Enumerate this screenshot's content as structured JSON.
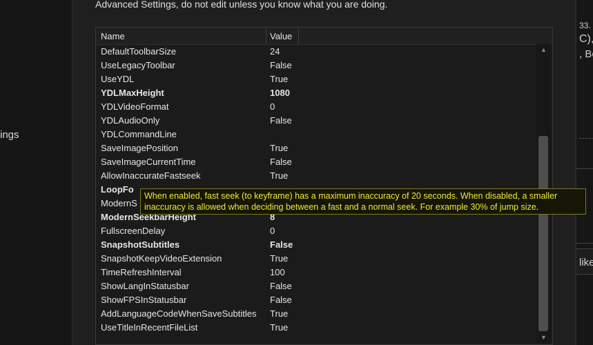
{
  "left_panel": {
    "label_fragment": "ings"
  },
  "main": {
    "heading": "Advanced Settings, do not edit unless you know what you are doing."
  },
  "grid": {
    "columns": [
      "Name",
      "Value"
    ],
    "rows": [
      {
        "name": "DefaultToolbarSize",
        "value": "24",
        "bold": false
      },
      {
        "name": "UseLegacyToolbar",
        "value": "False",
        "bold": false
      },
      {
        "name": "UseYDL",
        "value": "True",
        "bold": false
      },
      {
        "name": "YDLMaxHeight",
        "value": "1080",
        "bold": true
      },
      {
        "name": "YDLVideoFormat",
        "value": "0",
        "bold": false
      },
      {
        "name": "YDLAudioOnly",
        "value": "False",
        "bold": false
      },
      {
        "name": "YDLCommandLine",
        "value": "",
        "bold": false
      },
      {
        "name": "SaveImagePosition",
        "value": "True",
        "bold": false
      },
      {
        "name": "SaveImageCurrentTime",
        "value": "False",
        "bold": false
      },
      {
        "name": "AllowInaccurateFastseek",
        "value": "True",
        "bold": false
      },
      {
        "name": "LoopFo",
        "value": "",
        "bold": true
      },
      {
        "name": "ModernS",
        "value": "",
        "bold": false
      },
      {
        "name": "ModernSeekbarHeight",
        "value": "8",
        "bold": true
      },
      {
        "name": "FullscreenDelay",
        "value": "0",
        "bold": false
      },
      {
        "name": "SnapshotSubtitles",
        "value": "False",
        "bold": true
      },
      {
        "name": "SnapshotKeepVideoExtension",
        "value": "True",
        "bold": false
      },
      {
        "name": "TimeRefreshInterval",
        "value": "100",
        "bold": false
      },
      {
        "name": "ShowLangInStatusbar",
        "value": "False",
        "bold": false
      },
      {
        "name": "ShowFPSInStatusbar",
        "value": "False",
        "bold": false
      },
      {
        "name": "AddLanguageCodeWhenSaveSubtitles",
        "value": "True",
        "bold": false
      },
      {
        "name": "UseTitleInRecentFileList",
        "value": "True",
        "bold": false
      }
    ]
  },
  "scrollbar": {
    "up_glyph": "▲",
    "down_glyph": "▼"
  },
  "tooltip": {
    "text": "When enabled, fast seek (to keyframe) has a maximum inaccuracy of 20 seconds. When disabled, a smaller inaccuracy is allowed when deciding between a fast and a normal seek. For example 30% of jump size."
  },
  "right_strip": {
    "fragments": [
      "33.",
      "C),",
      ", Bo",
      "like"
    ]
  },
  "colors": {
    "tooltip_text": "#f0ea3a",
    "tooltip_border": "#7e7a20",
    "background": "#1f1f1f"
  }
}
